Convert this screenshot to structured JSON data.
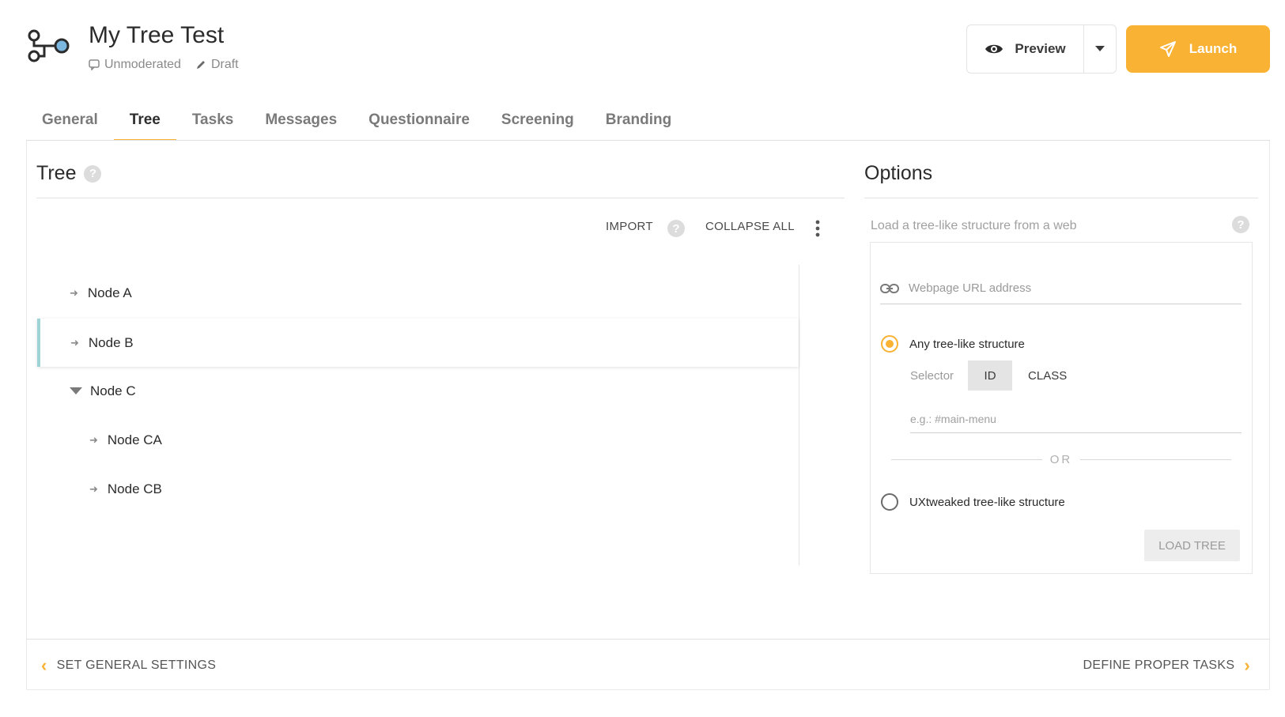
{
  "header": {
    "title": "My Tree Test",
    "mode": "Unmoderated",
    "status": "Draft",
    "preview_label": "Preview",
    "launch_label": "Launch"
  },
  "tabs": [
    {
      "label": "General"
    },
    {
      "label": "Tree"
    },
    {
      "label": "Tasks"
    },
    {
      "label": "Messages"
    },
    {
      "label": "Questionnaire"
    },
    {
      "label": "Screening"
    },
    {
      "label": "Branding"
    }
  ],
  "active_tab": "Tree",
  "tree_panel": {
    "heading": "Tree",
    "import_label": "IMPORT",
    "collapse_label": "COLLAPSE ALL",
    "nodes": [
      {
        "label": "Node A"
      },
      {
        "label": "Node B"
      },
      {
        "label": "Node C"
      },
      {
        "label": "Node CA"
      },
      {
        "label": "Node CB"
      }
    ]
  },
  "options_panel": {
    "heading": "Options",
    "description": "Load a tree-like structure from a web",
    "url_placeholder": "Webpage URL address",
    "option_any": "Any tree-like structure",
    "selector_label": "Selector",
    "selector_id": "ID",
    "selector_class": "CLASS",
    "selector_placeholder": "e.g.:  #main-menu",
    "or_label": "OR",
    "option_uxtweaked": "UXtweaked tree-like structure",
    "load_button": "LOAD TREE"
  },
  "footer": {
    "prev_label": "SET GENERAL SETTINGS",
    "next_label": "DEFINE PROPER TASKS"
  },
  "colors": {
    "accent": "#f9b234",
    "highlight": "#9fd4d7"
  }
}
